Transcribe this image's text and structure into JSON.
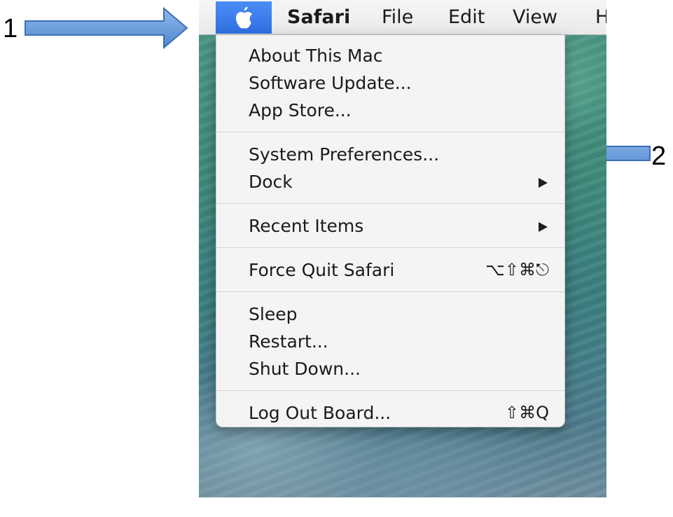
{
  "menubar": {
    "apple_icon": "apple-icon",
    "app_menu": "Safari",
    "file_menu": "File",
    "edit_menu": "Edit",
    "view_menu": "View",
    "help_menu_partial": "H"
  },
  "apple_menu": {
    "group1": [
      {
        "label": "About This Mac"
      },
      {
        "label": "Software Update..."
      },
      {
        "label": "App Store..."
      }
    ],
    "group2": [
      {
        "label": "System Preferences..."
      },
      {
        "label": "Dock",
        "submenu_icon": "submenu-arrow-icon"
      }
    ],
    "group3": [
      {
        "label": "Recent Items",
        "submenu_icon": "submenu-arrow-icon"
      }
    ],
    "group4": [
      {
        "label": "Force Quit Safari",
        "shortcut": "⌥⇧⌘⎋"
      }
    ],
    "group5": [
      {
        "label": "Sleep"
      },
      {
        "label": "Restart..."
      },
      {
        "label": "Shut Down..."
      }
    ],
    "group6": [
      {
        "label": "Log Out Board...",
        "shortcut": "⇧⌘Q"
      }
    ]
  },
  "annotations": {
    "callout_1": "1",
    "callout_2": "2"
  },
  "colors": {
    "apple_highlight": "#2f6fe3",
    "callout_arrow_fill": "#5b93d8",
    "callout_arrow_stroke": "#3f6fb4"
  }
}
